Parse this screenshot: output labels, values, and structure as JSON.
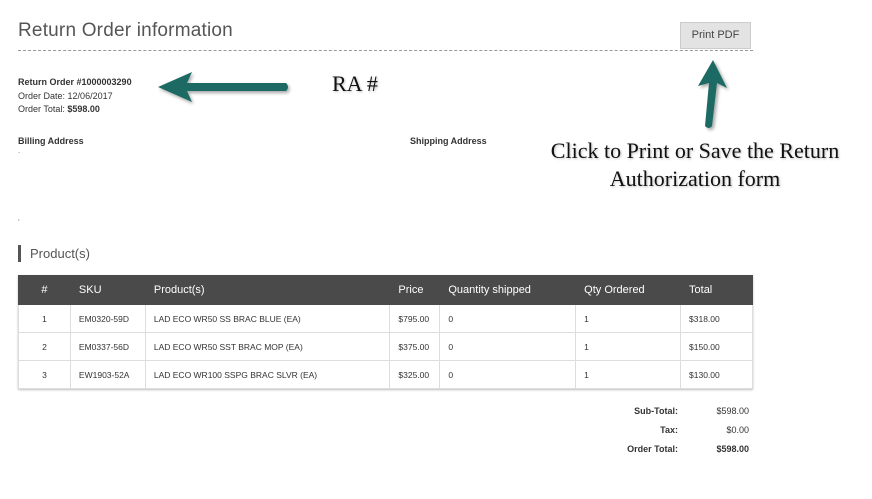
{
  "header": {
    "title": "Return Order information",
    "print_button": "Print PDF"
  },
  "order": {
    "number_label": "Return Order #1000003290",
    "date_label": "Order Date:",
    "date": "12/06/2017",
    "total_label": "Order Total:",
    "total": "$598.00"
  },
  "addresses": {
    "billing_label": "Billing Address",
    "shipping_label": "Shipping Address",
    "billing_value": "."
  },
  "products": {
    "section_title": "Product(s)",
    "columns": [
      "#",
      "SKU",
      "Product(s)",
      "Price",
      "Quantity shipped",
      "Qty Ordered",
      "Total"
    ],
    "rows": [
      {
        "num": "1",
        "sku": "EM0320-59D",
        "name": "LAD ECO WR50 SS BRAC BLUE (EA)",
        "price": "$795.00",
        "shipped": "0",
        "ordered": "1",
        "total": "$318.00"
      },
      {
        "num": "2",
        "sku": "EM0337-56D",
        "name": "LAD ECO WR50 SST BRAC MOP (EA)",
        "price": "$375.00",
        "shipped": "0",
        "ordered": "1",
        "total": "$150.00"
      },
      {
        "num": "3",
        "sku": "EW1903-52A",
        "name": "LAD ECO WR100 SSPG BRAC SLVR (EA)",
        "price": "$325.00",
        "shipped": "0",
        "ordered": "1",
        "total": "$130.00"
      }
    ]
  },
  "totals": {
    "subtotal_label": "Sub-Total:",
    "subtotal": "$598.00",
    "tax_label": "Tax:",
    "tax": "$0.00",
    "grand_label": "Order Total:",
    "grand": "$598.00"
  },
  "annotations": {
    "ra_note": "RA #",
    "print_note_line1": "Click to Print or Save the Return",
    "print_note_line2": "Authorization form",
    "arrow_color": "#1f6b63"
  }
}
